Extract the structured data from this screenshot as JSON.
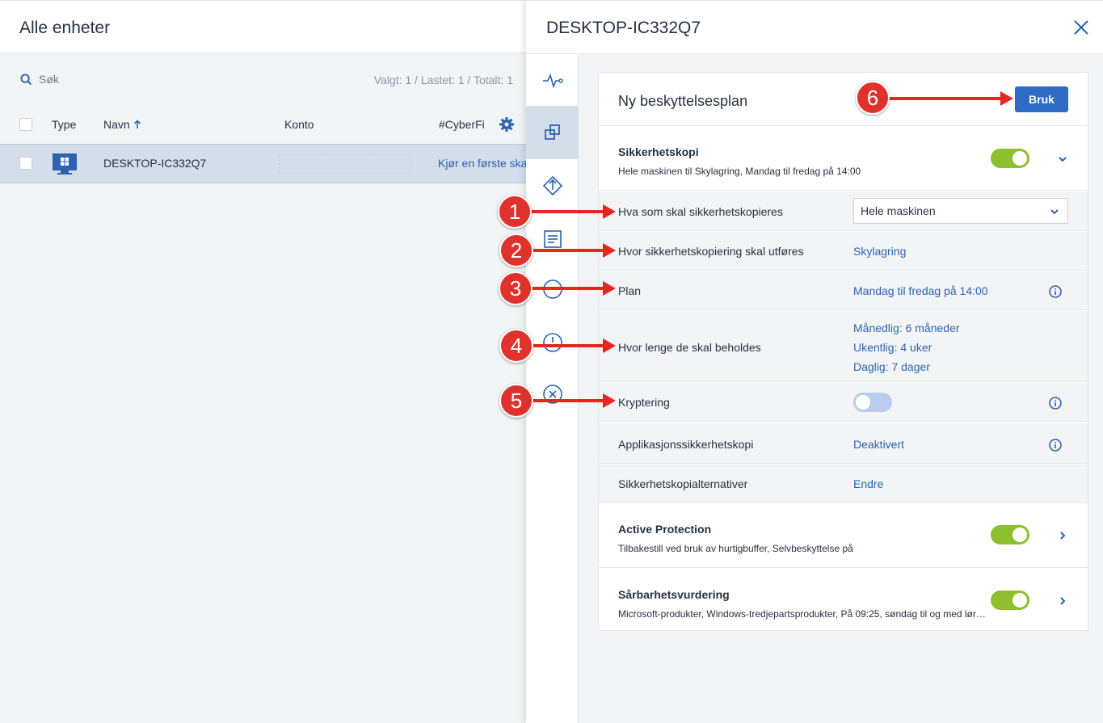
{
  "left": {
    "title": "Alle enheter",
    "search_label": "Søk",
    "counts": "Valgt: 1 / Lastet: 1 / Totalt: 1",
    "columns": {
      "type": "Type",
      "name": "Navn",
      "account": "Konto",
      "cyberfit": "#CyberFi"
    },
    "row": {
      "name": "DESKTOP-IC332Q7",
      "cyberfit": "Kjør en første ska"
    }
  },
  "panel": {
    "title": "DESKTOP-IC332Q7",
    "plan_title": "Ny beskyttelsesplan",
    "apply_label": "Bruk",
    "backup": {
      "title": "Sikkerhetskopi",
      "subtitle": "Hele maskinen til Skylagring, Mandag til fredag på 14:00",
      "enabled": true
    },
    "rows": {
      "what": {
        "label": "Hva som skal sikkerhetskopieres",
        "value": "Hele maskinen"
      },
      "where": {
        "label": "Hvor sikkerhetskopiering skal utføres",
        "value": "Skylagring"
      },
      "schedule": {
        "label": "Plan",
        "value": "Mandag til fredag på 14:00"
      },
      "retention": {
        "label": "Hvor lenge de skal beholdes",
        "monthly": "Månedlig: 6 måneder",
        "weekly": "Ukentlig: 4 uker",
        "daily": "Daglig: 7 dager"
      },
      "encryption": {
        "label": "Kryptering",
        "enabled": false
      },
      "app_backup": {
        "label": "Applikasjonssikkerhetskopi",
        "value": "Deaktivert"
      },
      "options": {
        "label": "Sikkerhetskopialternativer",
        "value": "Endre"
      }
    },
    "active_protection": {
      "title": "Active Protection",
      "subtitle": "Tilbakestill ved bruk av hurtigbuffer, Selvbeskyttelse på",
      "enabled": true
    },
    "vulnerability": {
      "title": "Sårbarhetsvurdering",
      "subtitle": "Microsoft-produkter, Windows-tredjepartsprodukter, På 09:25, søndag til og med lørdag",
      "enabled": true
    }
  },
  "annotations": [
    "1",
    "2",
    "3",
    "4",
    "5",
    "6"
  ],
  "colors": {
    "accent": "#2d6bc4",
    "toggle_on": "#8dbf2e",
    "toggle_off": "#b9cdef",
    "annotation": "#e0322d"
  }
}
